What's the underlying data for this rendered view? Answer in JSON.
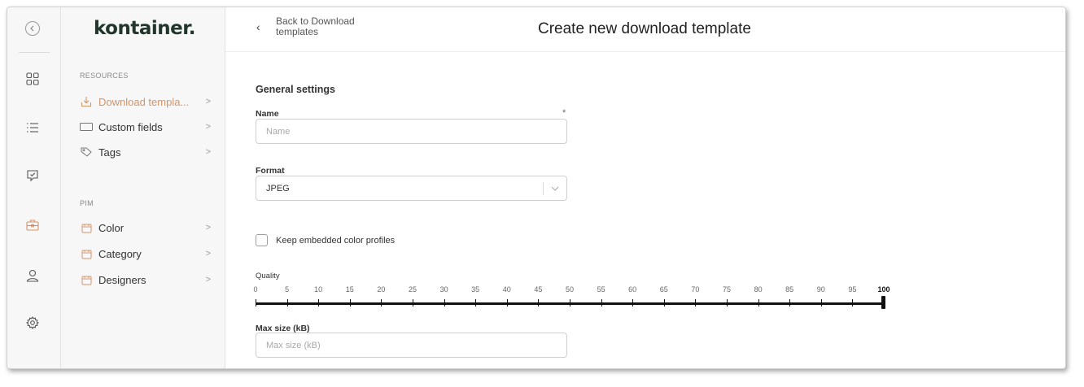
{
  "app": {
    "logo": "kontainer."
  },
  "rail": {
    "icons": [
      "collapse-icon",
      "grid-icon",
      "list-icon",
      "approval-icon",
      "briefcase-icon",
      "user-icon",
      "settings-icon"
    ],
    "active_color": "#d4946a"
  },
  "sidebar": {
    "sections": [
      {
        "label": "RESOURCES",
        "items": [
          {
            "label": "Download templa...",
            "icon": "download-icon",
            "active": true
          },
          {
            "label": "Custom fields",
            "icon": "field-icon",
            "active": false
          },
          {
            "label": "Tags",
            "icon": "tag-icon",
            "active": false
          }
        ]
      },
      {
        "label": "PIM",
        "items": [
          {
            "label": "Color",
            "icon": "folder-icon",
            "active": false
          },
          {
            "label": "Category",
            "icon": "folder-icon",
            "active": false
          },
          {
            "label": "Designers",
            "icon": "folder-icon",
            "active": false
          }
        ]
      }
    ],
    "chevron": ">"
  },
  "header": {
    "back_label": "Back to Download templates",
    "title": "Create new download template"
  },
  "form": {
    "section_title": "General settings",
    "name": {
      "label": "Name",
      "required_mark": "*",
      "placeholder": "Name",
      "value": ""
    },
    "format": {
      "label": "Format",
      "value": "JPEG"
    },
    "keep_profiles": {
      "label": "Keep embedded color profiles",
      "checked": false
    },
    "quality": {
      "label": "Quality",
      "ticks": [
        "0",
        "5",
        "10",
        "15",
        "20",
        "25",
        "30",
        "35",
        "40",
        "45",
        "50",
        "55",
        "60",
        "65",
        "70",
        "75",
        "80",
        "85",
        "90",
        "95",
        "100"
      ],
      "value": 100,
      "min": 0,
      "max": 100
    },
    "max_size": {
      "label": "Max size (kB)",
      "placeholder": "Max size (kB)",
      "value": ""
    }
  }
}
